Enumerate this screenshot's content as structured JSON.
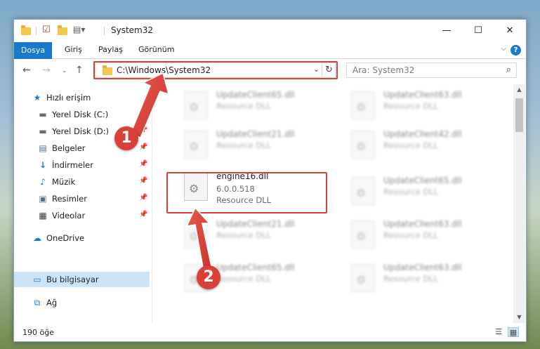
{
  "window": {
    "title": "System32",
    "controls": {
      "minimize": "—",
      "maximize": "☐",
      "close": "✕"
    }
  },
  "ribbon": {
    "tabs": [
      {
        "label": "Dosya",
        "active": true
      },
      {
        "label": "Giriş"
      },
      {
        "label": "Paylaş"
      },
      {
        "label": "Görünüm"
      }
    ],
    "help": "?"
  },
  "navigation": {
    "address": "C:\\Windows\\System32",
    "search_placeholder": "Ara: System32"
  },
  "sidebar": {
    "items": [
      {
        "label": "Hızlı erişim",
        "icon": "star-icon"
      },
      {
        "label": "Yerel Disk (C:)",
        "icon": "drive-icon"
      },
      {
        "label": "Yerel Disk (D:)",
        "icon": "drive-icon"
      },
      {
        "label": "Belgeler",
        "icon": "documents-icon"
      },
      {
        "label": "İndirmeler",
        "icon": "download-icon"
      },
      {
        "label": "Müzik",
        "icon": "music-icon"
      },
      {
        "label": "Resimler",
        "icon": "pictures-icon"
      },
      {
        "label": "Videolar",
        "icon": "video-icon"
      },
      {
        "label": "OneDrive",
        "icon": "cloud-icon"
      },
      {
        "label": "Bu bilgisayar",
        "icon": "computer-icon"
      },
      {
        "label": "Ağ",
        "icon": "network-icon"
      }
    ]
  },
  "files": [
    {
      "name": "UpdateClient65.dll",
      "desc": "Resource DLL"
    },
    {
      "name": "UpdateClient63.dll",
      "desc": "Resource DLL"
    },
    {
      "name": "UpdateClient21.dll",
      "desc": "Resource DLL"
    },
    {
      "name": "UpdateClient42.dll",
      "desc": "Resource DLL"
    },
    {
      "name": "engine16.dll",
      "version": "6.0.0.518",
      "desc": "Resource DLL"
    },
    {
      "name": "UpdateClient65.dll",
      "desc": "Resource DLL"
    },
    {
      "name": "UpdateClient21.dll",
      "desc": "Resource DLL"
    },
    {
      "name": "UpdateClient63.dll",
      "desc": "Resource DLL"
    },
    {
      "name": "UpdateClient65.dll",
      "desc": "Resource DLL"
    },
    {
      "name": "UpdateClient63.dll",
      "desc": "Resource DLL"
    }
  ],
  "status": {
    "count": "190 öğe"
  },
  "annotations": {
    "step1": "1",
    "step2": "2",
    "color": "#d9403a"
  }
}
